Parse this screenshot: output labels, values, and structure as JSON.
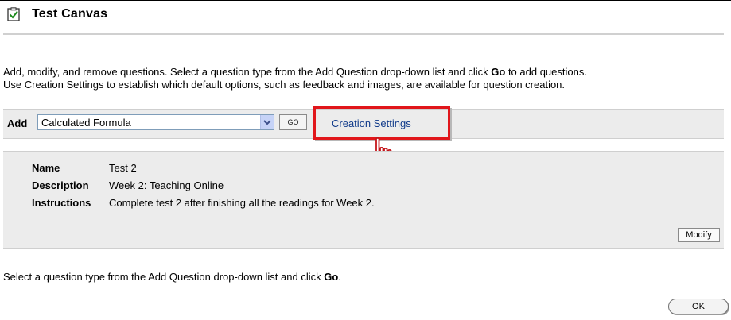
{
  "header": {
    "title": "Test Canvas",
    "icon": "test-checklist-icon"
  },
  "intro": {
    "line1_before": "Add, modify, and remove questions. Select a question type from the Add Question drop-down list and click ",
    "line1_bold": "Go",
    "line1_after": " to add questions.",
    "line2": "Use Creation Settings to establish which default options, such as feedback and images, are available for question creation."
  },
  "toolbar": {
    "add_label": "Add",
    "question_type_selected": "Calculated Formula",
    "go_label": "GO",
    "creation_settings_label": "Creation Settings"
  },
  "test_info": {
    "name_label": "Name",
    "name_value": "Test 2",
    "description_label": "Description",
    "description_value": "Week 2: Teaching Online",
    "instructions_label": "Instructions",
    "instructions_value": "Complete test 2 after finishing all the readings for Week 2.",
    "modify_label": "Modify"
  },
  "footer": {
    "text_before": "Select a question type from the Add Question drop-down list and click ",
    "text_bold": "Go",
    "text_after": ".",
    "ok_label": "OK"
  },
  "colors": {
    "highlight": "#e1161b",
    "link": "#103a8a",
    "panel_bg": "#ececec"
  }
}
